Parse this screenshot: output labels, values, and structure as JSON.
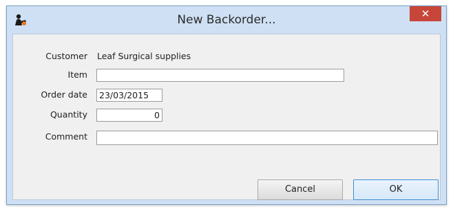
{
  "window": {
    "title": "New Backorder...",
    "close_glyph": "✕",
    "icon": "app-logo-icon",
    "accent_color": "#c7463a",
    "frame_color": "#cfe0f4"
  },
  "form": {
    "customer": {
      "label": "Customer",
      "value": "Leaf Surgical supplies"
    },
    "item": {
      "label": "Item",
      "value": ""
    },
    "order_date": {
      "label": "Order date",
      "value": "23/03/2015"
    },
    "quantity": {
      "label": "Quantity",
      "value": "0"
    },
    "comment": {
      "label": "Comment",
      "value": ""
    }
  },
  "buttons": {
    "cancel_label": "Cancel",
    "ok_label": "OK"
  }
}
